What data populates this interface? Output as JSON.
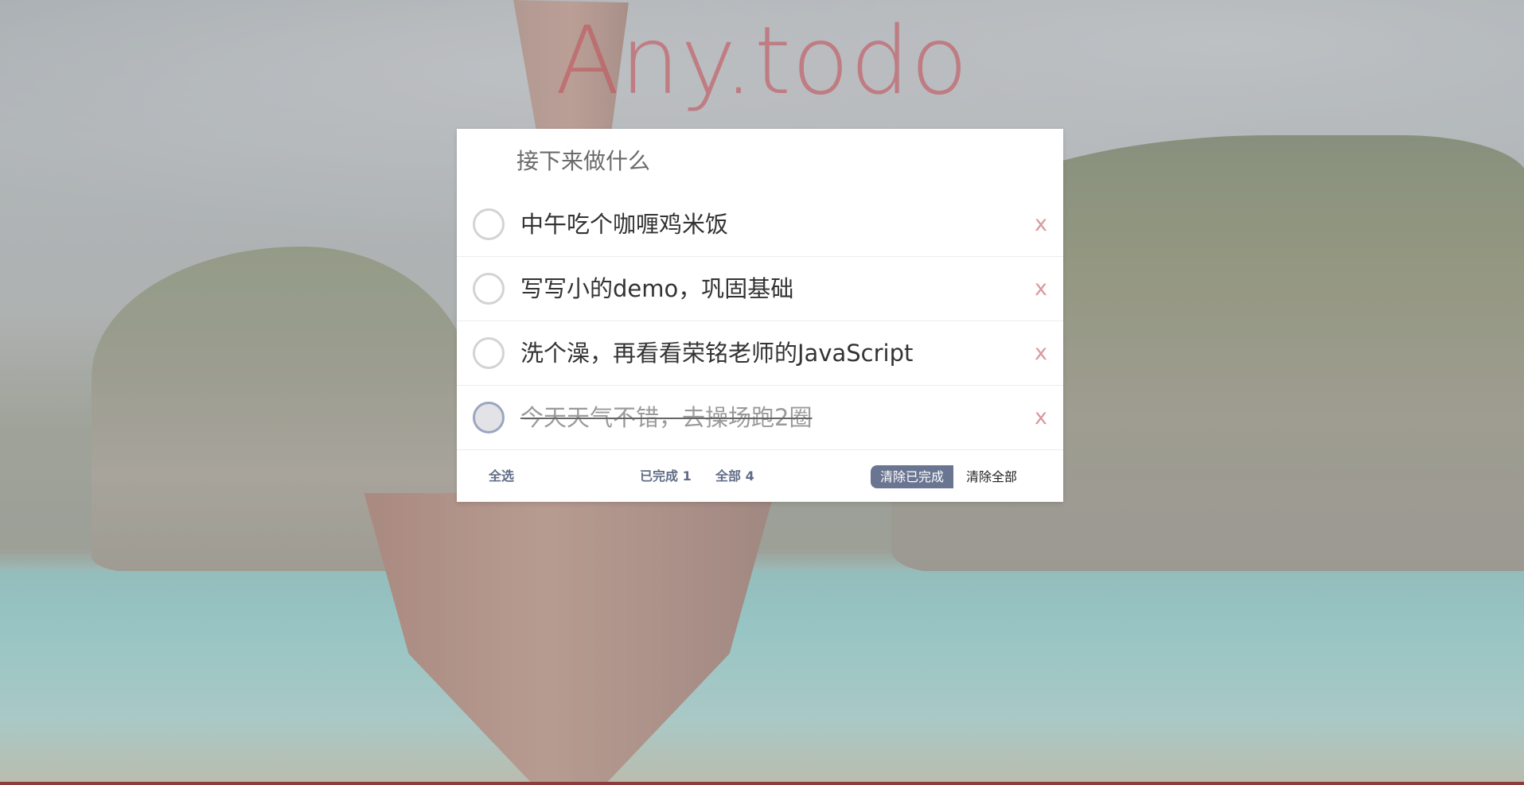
{
  "app": {
    "title": "Any.todo"
  },
  "input": {
    "placeholder": "接下来做什么",
    "value": ""
  },
  "todos": [
    {
      "text": "中午吃个咖喱鸡米饭",
      "completed": false,
      "delete_label": "x"
    },
    {
      "text": "写写小的demo，巩固基础",
      "completed": false,
      "delete_label": "x"
    },
    {
      "text": "洗个澡，再看看荣铭老师的JavaScript",
      "completed": false,
      "delete_label": "x"
    },
    {
      "text": "今天天气不错，去操场跑2圈",
      "completed": true,
      "delete_label": "x"
    }
  ],
  "footer": {
    "select_all": "全选",
    "completed_count": "已完成 1",
    "all_count": "全部 4",
    "clear_completed": "清除已完成",
    "clear_all": "清除全部"
  },
  "colors": {
    "title": "#c1565e",
    "accent": "#6a7691",
    "delete": "#d99a9d",
    "completed_toggle_border": "#9ba6c0"
  }
}
